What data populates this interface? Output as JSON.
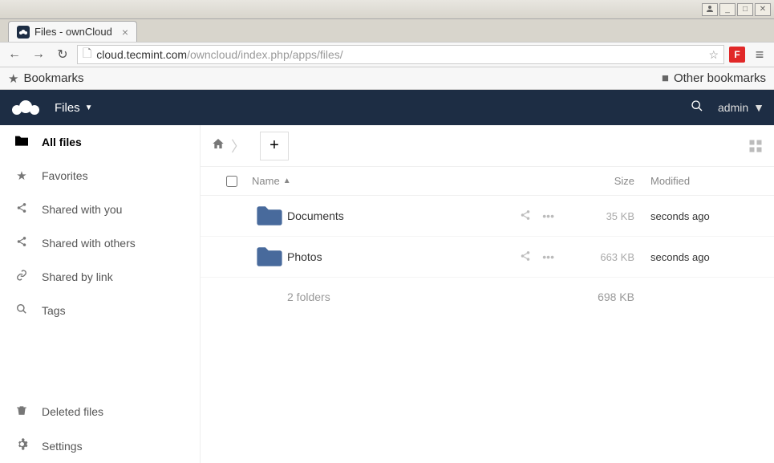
{
  "window": {
    "tab_title": "Files - ownCloud",
    "url_host": "cloud.tecmint.com",
    "url_path": "/owncloud/index.php/apps/files/",
    "bookmarks_label": "Bookmarks",
    "other_bookmarks_label": "Other bookmarks"
  },
  "app": {
    "nav_label": "Files",
    "user_name": "admin"
  },
  "sidebar": {
    "items": [
      {
        "label": "All files",
        "icon": "folder",
        "name": "all-files",
        "active": true
      },
      {
        "label": "Favorites",
        "icon": "star",
        "name": "favorites",
        "active": false
      },
      {
        "label": "Shared with you",
        "icon": "share",
        "name": "shared-with-you",
        "active": false
      },
      {
        "label": "Shared with others",
        "icon": "share",
        "name": "shared-with-others",
        "active": false
      },
      {
        "label": "Shared by link",
        "icon": "link",
        "name": "shared-by-link",
        "active": false
      },
      {
        "label": "Tags",
        "icon": "search",
        "name": "tags",
        "active": false
      }
    ],
    "bottom": [
      {
        "label": "Deleted files",
        "icon": "trash",
        "name": "deleted-files"
      },
      {
        "label": "Settings",
        "icon": "gear",
        "name": "settings"
      }
    ]
  },
  "filelist": {
    "headers": {
      "name": "Name",
      "size": "Size",
      "modified": "Modified"
    },
    "rows": [
      {
        "name": "Documents",
        "size": "35 KB",
        "modified": "seconds ago"
      },
      {
        "name": "Photos",
        "size": "663 KB",
        "modified": "seconds ago"
      }
    ],
    "summary": {
      "label": "2 folders",
      "size": "698 KB"
    }
  }
}
